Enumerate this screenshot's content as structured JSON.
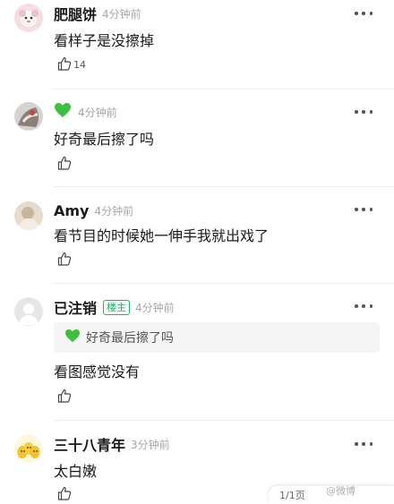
{
  "comments": [
    {
      "user": "肥腿饼",
      "time": "4分钟前",
      "text": "看样子是没擦掉",
      "likes": "14"
    },
    {
      "user": "",
      "user_icon": "green-heart-icon",
      "time": "4分钟前",
      "text": "好奇最后擦了吗"
    },
    {
      "user": "Amy",
      "time": "4分钟前",
      "text": "看节目的时候她一伸手我就出戏了"
    },
    {
      "user": "已注销",
      "badge": "楼主",
      "time": "4分钟前",
      "quote": "好奇最后擦了吗",
      "quote_icon": "green-heart-icon",
      "text": "看图感觉没有"
    },
    {
      "user": "三十八青年",
      "time": "3分钟前",
      "text": "太白嫩"
    }
  ],
  "pagination": {
    "label": "1/1页"
  },
  "watermark": "@微博"
}
